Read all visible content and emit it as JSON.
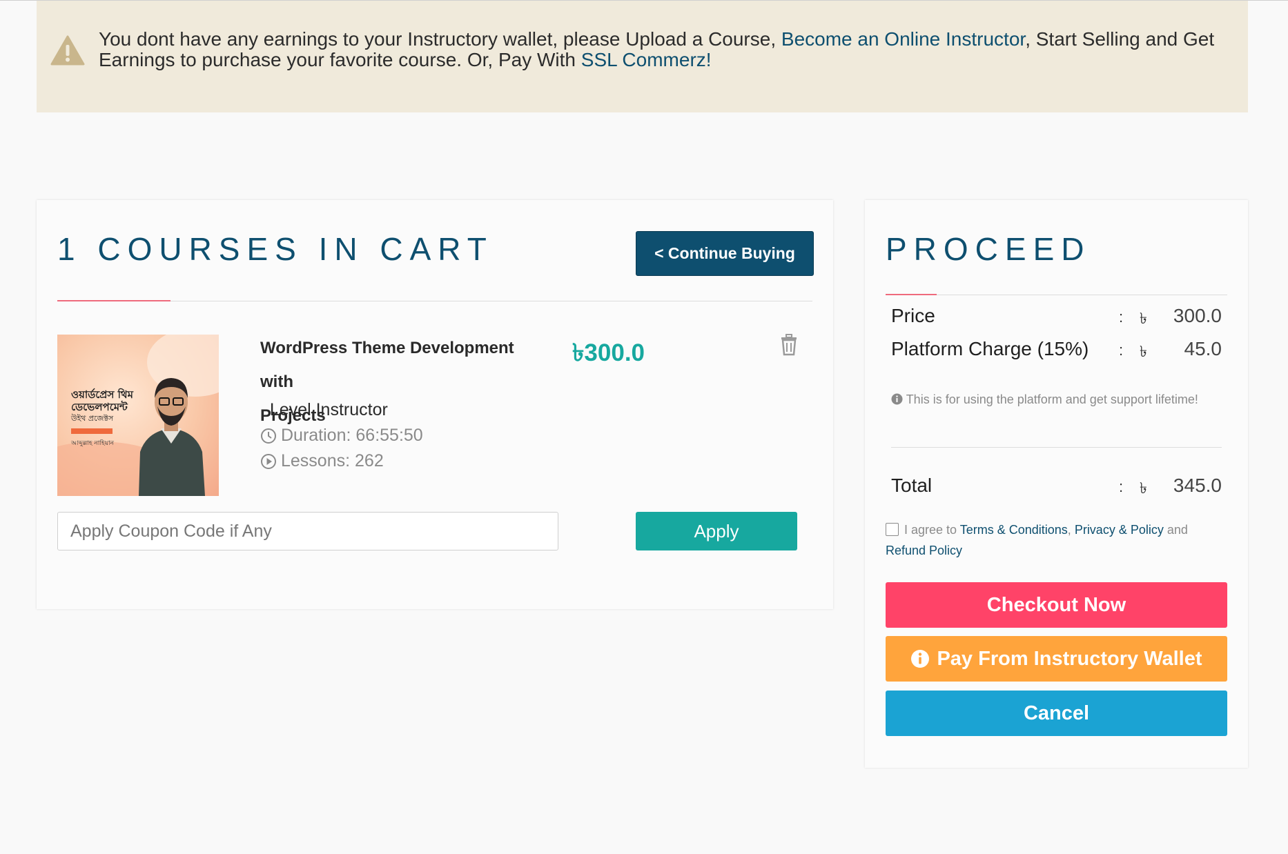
{
  "alert": {
    "text_1": "You dont have any earnings to your Instructory wallet, please Upload a Course, ",
    "link_instructor": "Become an Online Instructor",
    "text_2": ", Start Selling and Get Earnings to purchase your favorite course. Or, Pay With ",
    "link_ssl": "SSL Commerz!"
  },
  "cart": {
    "heading": "1 COURSES IN CART",
    "continue_label": "< Continue Buying",
    "course": {
      "title_line1": "WordPress Theme Development with",
      "title_line2": "Projects",
      "price": "৳300.0",
      "instructor": ", Level Instructor",
      "duration": "Duration: 66:55:50",
      "lessons": "Lessons: 262",
      "thumb_text_1": "ওয়ার্ডপ্রেস থিম",
      "thumb_text_2": "ডেভেলপমেন্ট",
      "thumb_text_3": "উইথ প্রজেক্টস",
      "thumb_text_4": "আব্দুল্লাহ নাহিয়ান"
    },
    "coupon_placeholder": "Apply Coupon Code if Any",
    "apply_label": "Apply"
  },
  "proceed": {
    "heading": "PROCEED",
    "price_label": "Price",
    "price_value": "300.0",
    "charge_label": "Platform Charge (15%)",
    "charge_value": "45.0",
    "colon": ":",
    "currency": "৳",
    "note": "This is for using the platform and get support lifetime!",
    "total_label": "Total",
    "total_value": "345.0",
    "agree_text": "I agree to ",
    "terms_link": "Terms & Conditions",
    "comma": ", ",
    "privacy_link": "Privacy & Policy",
    "and_text": " and",
    "refund_link": "Refund Policy",
    "checkout_label": "Checkout Now",
    "wallet_label": "Pay From Instructory Wallet",
    "cancel_label": "Cancel"
  },
  "colors": {
    "primary": "#0e4f6f",
    "teal": "#17a89f",
    "checkout": "#ff4368",
    "wallet": "#ffa43c",
    "cancel": "#1ba3d3",
    "alert_bg": "#f0eadb"
  },
  "icons": [
    "warning-icon",
    "trash-icon",
    "clock-icon",
    "play-circle-icon",
    "info-icon",
    "checkbox-icon"
  ]
}
